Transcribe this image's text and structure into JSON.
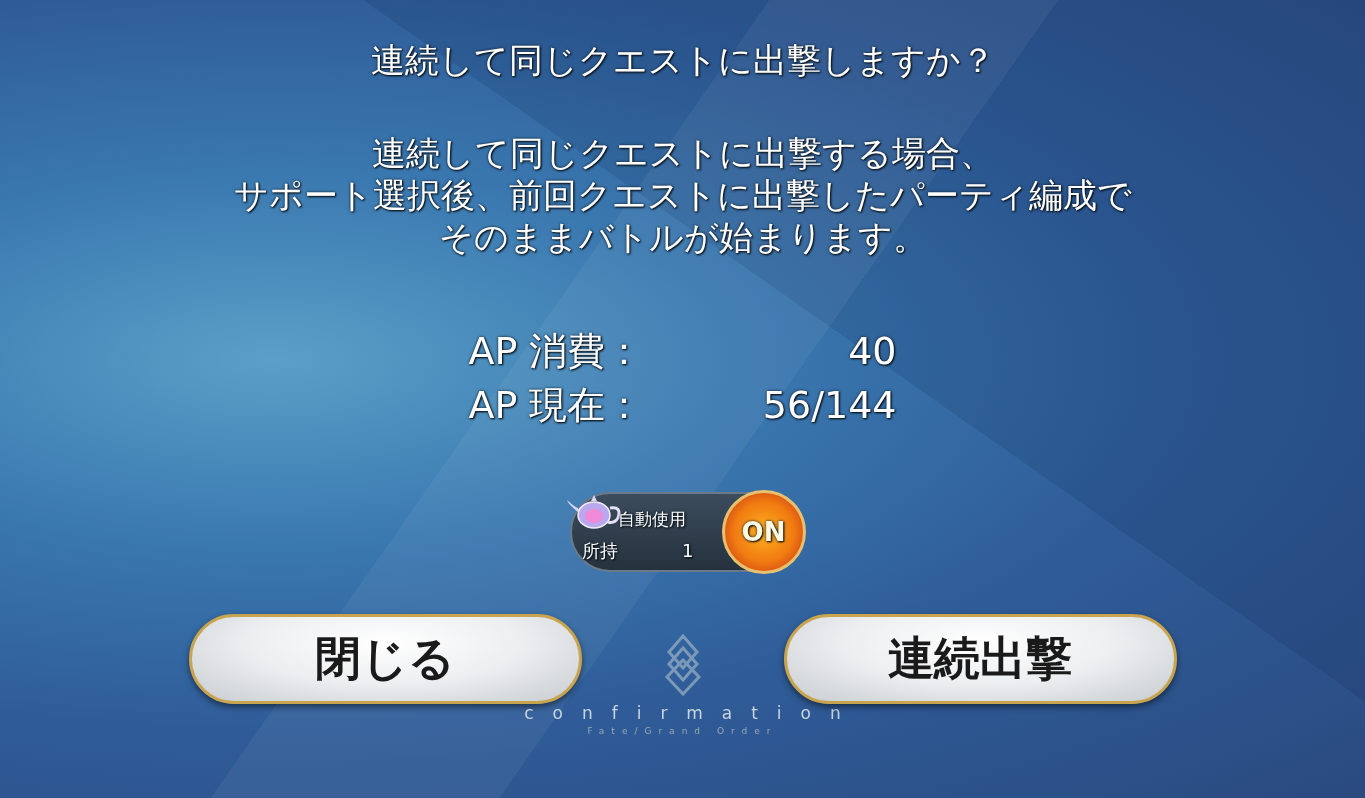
{
  "title": "連続して同じクエストに出撃しますか？",
  "message": [
    "連続して同じクエストに出撃する場合、",
    "サポート選択後、前回クエストに出撃したパーティ編成で",
    "そのままバトルが始まります。"
  ],
  "ap": [
    {
      "label": "AP 消費：",
      "value": "40"
    },
    {
      "label": "AP 現在：",
      "value": "56/144"
    }
  ],
  "auto_use": {
    "label": "自動使用",
    "count_label": "所持",
    "count": "1",
    "toggle": "ON",
    "on": true
  },
  "buttons": [
    {
      "label": "閉じる"
    },
    {
      "label": "連続出撃"
    }
  ],
  "footer": {
    "caption": "confirmation",
    "subtitle": "Fate/Grand Order"
  }
}
